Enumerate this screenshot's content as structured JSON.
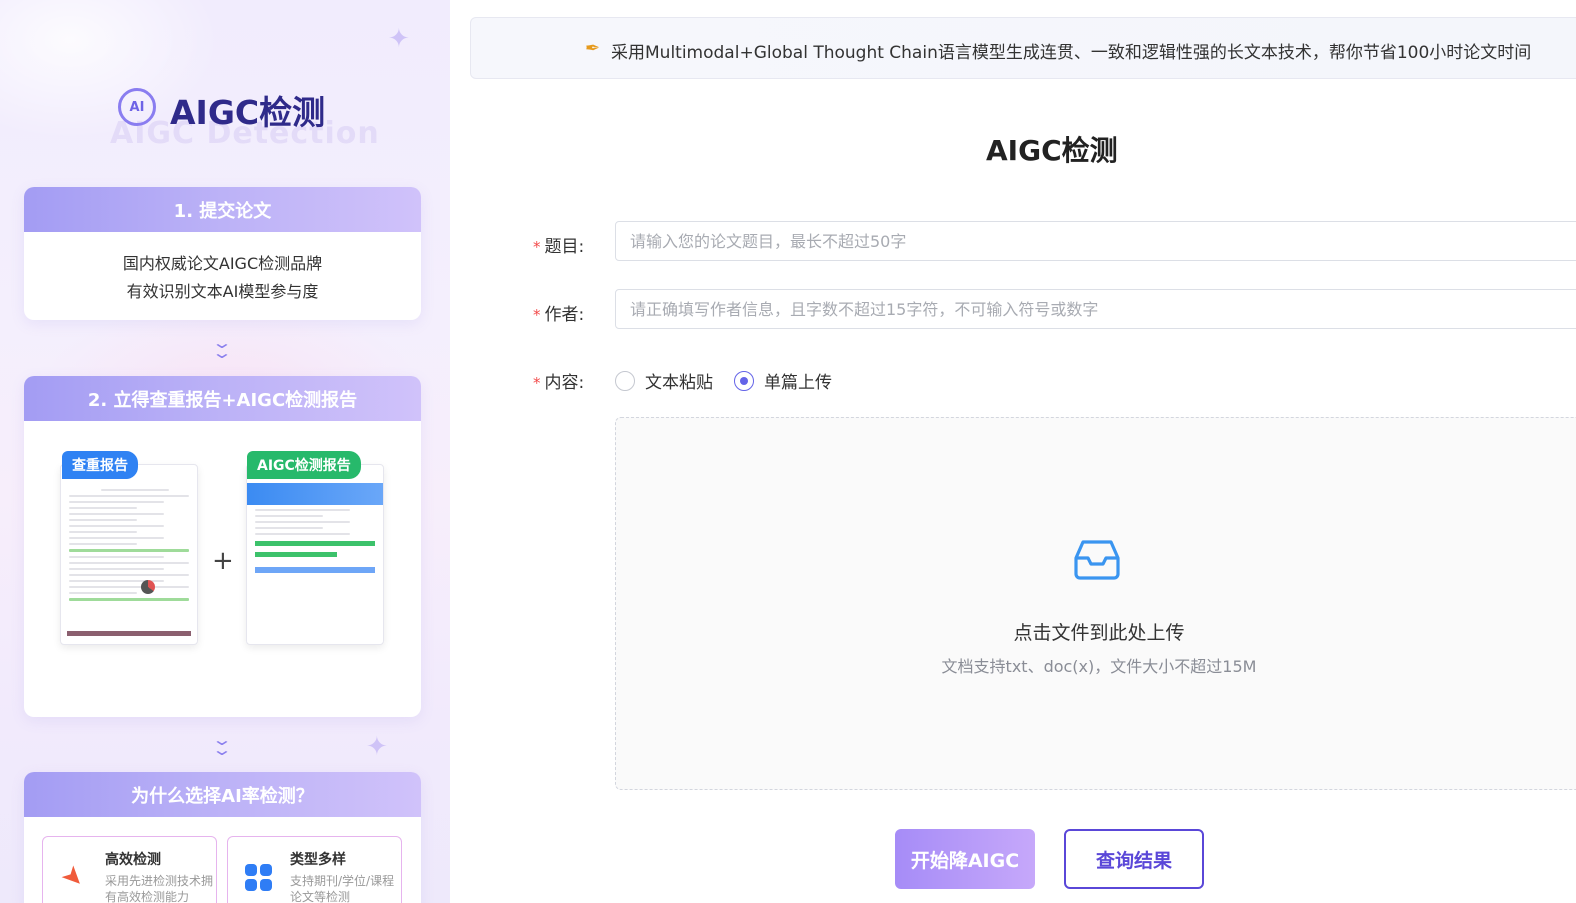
{
  "left": {
    "brand": {
      "logo_text": "AI",
      "title": "AIGC检测",
      "watermark": "AIGC Detection"
    },
    "step1": {
      "title": "1. 提交论文",
      "line1": "国内权威论文AIGC检测品牌",
      "line2": "有效识别文本AI模型参与度"
    },
    "step2": {
      "title": "2. 立得查重报告+AIGC检测报告",
      "report1_tag": "查重报告",
      "report2_tag": "AIGC检测报告",
      "plus": "+"
    },
    "why": {
      "title": "为什么选择AI率检测？",
      "items": [
        {
          "title": "高效检测",
          "desc": "采用先进检测技术拥有高效检测能力"
        },
        {
          "title": "类型多样",
          "desc": "支持期刊/学位/课程论文等检测"
        }
      ]
    }
  },
  "banner": {
    "text": "采用Multimodal+Global Thought Chain语言模型生成连贯、一致和逻辑性强的长文本技术，帮你节省100小时论文时间"
  },
  "form": {
    "page_title": "AIGC检测",
    "title_label": "题目:",
    "title_placeholder": "请输入您的论文题目，最长不超过50字",
    "author_label": "作者:",
    "author_placeholder": "请正确填写作者信息，且字数不超过15字符，不可输入符号或数字",
    "content_label": "内容:",
    "content_options": [
      "文本粘贴",
      "单篇上传"
    ],
    "content_selected": "单篇上传",
    "upload_title": "点击文件到此处上传",
    "upload_hint": "文档支持txt、doc(x)，文件大小不超过15M",
    "start_button": "开始降AIGC",
    "query_button": "查询结果"
  },
  "colors": {
    "accent": "#5a47d8",
    "required_star": "#f24a4a",
    "tag_blue": "#2f82f3",
    "tag_green": "#27b96b"
  }
}
